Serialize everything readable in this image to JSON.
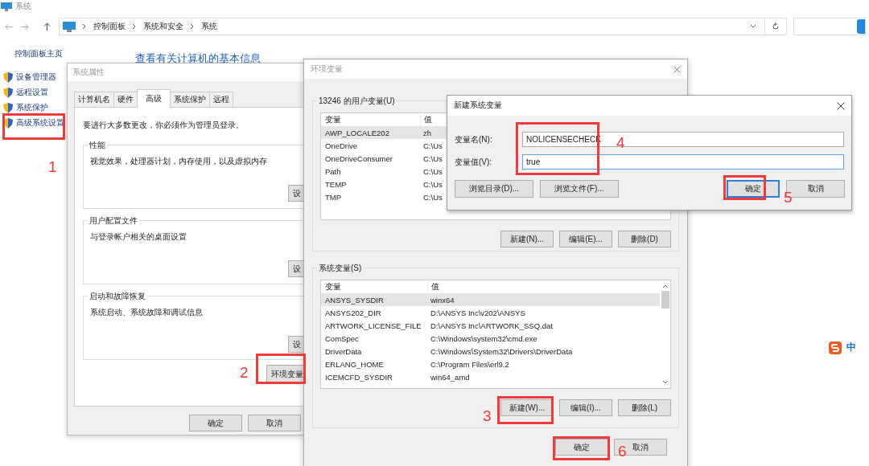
{
  "explorer": {
    "title": "系统",
    "breadcrumb": [
      "控制面板",
      "系统和安全",
      "系统"
    ],
    "sidebar_home": "控制面板主页",
    "sidebar_items": [
      "设备管理器",
      "远程设置",
      "系统保护",
      "高级系统设置"
    ],
    "heading": "查看有关计算机的基本信息",
    "ime_label": "中"
  },
  "system_properties": {
    "title": "系统属性",
    "tabs": [
      {
        "label": "计算机名",
        "selected": false
      },
      {
        "label": "硬件",
        "selected": false
      },
      {
        "label": "高级",
        "selected": true
      },
      {
        "label": "系统保护",
        "selected": false
      },
      {
        "label": "远程",
        "selected": false
      }
    ],
    "notice": "要进行大多数更改，你必须作为管理员登录。",
    "groups": [
      {
        "title": "性能",
        "text": "视觉效果，处理器计划，内存使用，以及虚拟内存",
        "button": "设"
      },
      {
        "title": "用户配置文件",
        "text": "与登录帐户相关的桌面设置",
        "button": "设"
      },
      {
        "title": "启动和故障恢复",
        "text": "系统启动、系统故障和调试信息",
        "button": "设"
      }
    ],
    "env_button": "环境变量",
    "buttons": [
      "确定",
      "取消"
    ]
  },
  "environment_variables": {
    "title": "环境变量",
    "user_group": "13246 的用户变量(U)",
    "user_columns": [
      "变量",
      "值"
    ],
    "user_rows": [
      {
        "name": "AWP_LOCALE202",
        "value": "zh",
        "selected": true
      },
      {
        "name": "OneDrive",
        "value": "C:\\Us",
        "selected": false
      },
      {
        "name": "OneDriveConsumer",
        "value": "C:\\Us",
        "selected": false
      },
      {
        "name": "Path",
        "value": "C:\\Us",
        "selected": false
      },
      {
        "name": "TEMP",
        "value": "C:\\Us",
        "selected": false
      },
      {
        "name": "TMP",
        "value": "C:\\Us",
        "selected": false
      }
    ],
    "user_buttons": [
      "新建(N)...",
      "编辑(E)...",
      "删除(D)"
    ],
    "system_group": "系统变量(S)",
    "system_columns": [
      "变量",
      "值"
    ],
    "system_rows": [
      {
        "name": "ANSYS_SYSDIR",
        "value": "winx64",
        "selected": true
      },
      {
        "name": "ANSYS202_DIR",
        "value": "D:\\ANSYS Inc\\v202\\ANSYS",
        "selected": false
      },
      {
        "name": "ARTWORK_LICENSE_FILE",
        "value": "D:\\ANSYS Inc\\ARTWORK_SSQ.dat",
        "selected": false
      },
      {
        "name": "ComSpec",
        "value": "C:\\Windows\\system32\\cmd.exe",
        "selected": false
      },
      {
        "name": "DriverData",
        "value": "C:\\Windows\\System32\\Drivers\\DriverData",
        "selected": false
      },
      {
        "name": "ERLANG_HOME",
        "value": "C:\\Program Files\\erl9.2",
        "selected": false
      },
      {
        "name": "ICEMCFD_SYSDIR",
        "value": "win64_amd",
        "selected": false
      }
    ],
    "system_buttons": [
      "新建(W)...",
      "编辑(I)...",
      "删除(L)"
    ],
    "buttons": [
      "确定",
      "取消"
    ]
  },
  "new_variable": {
    "title": "新建系统变量",
    "fields": [
      {
        "label": "变量名(N):",
        "value": "NOLICENSECHECK",
        "focused": false
      },
      {
        "label": "变量值(V):",
        "value": "true",
        "focused": true
      }
    ],
    "buttons": [
      {
        "label": "浏览目录(D)...",
        "default": false
      },
      {
        "label": "浏览文件(F)...",
        "default": false
      },
      {
        "label": "确定",
        "default": true
      },
      {
        "label": "取消",
        "default": false
      }
    ]
  },
  "annotations": [
    {
      "number": "1"
    },
    {
      "number": "2"
    },
    {
      "number": "3"
    },
    {
      "number": "4"
    },
    {
      "number": "5"
    },
    {
      "number": "6"
    }
  ]
}
